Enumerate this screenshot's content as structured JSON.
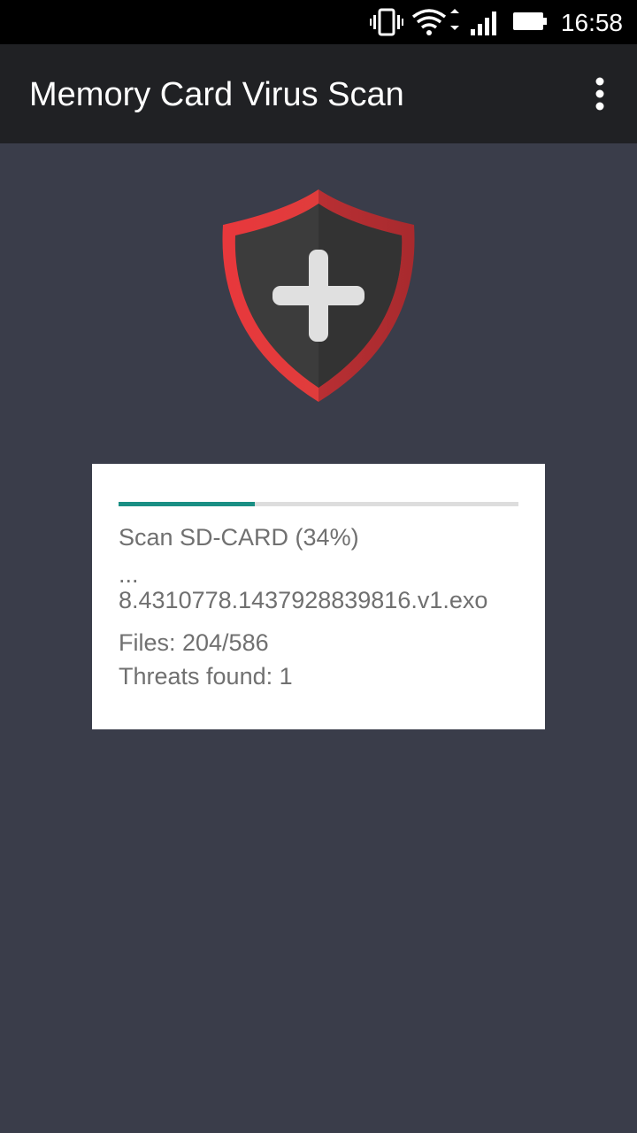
{
  "status_bar": {
    "time": "16:58",
    "icons": [
      "vibrate-icon",
      "wifi-icon",
      "signal-icon",
      "battery-icon"
    ]
  },
  "app_bar": {
    "title": "Memory Card Virus Scan",
    "menu_icon": "more-vert-icon"
  },
  "colors": {
    "background": "#3a3d4a",
    "app_bar": "#202124",
    "shield_red": "#e03c3c",
    "progress": "#1a8f84"
  },
  "scan": {
    "progress_percent": 34,
    "status_label": "Scan SD-CARD (34%)",
    "ellipsis": "...",
    "current_file": "8.4310778.1437928839816.v1.exo",
    "files_label": "Files: 204/586",
    "threats_label": "Threats found: 1"
  }
}
